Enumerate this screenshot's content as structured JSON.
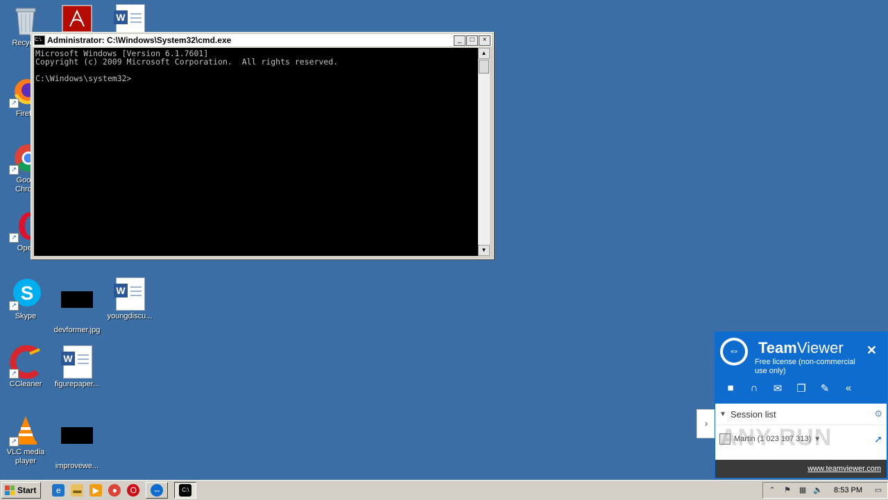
{
  "desktop": {
    "icons": [
      {
        "label": "Recycle"
      },
      {
        "label": "Firefo"
      },
      {
        "label": "Goog\nChron"
      },
      {
        "label": "Oper"
      },
      {
        "label": "Skype"
      },
      {
        "label": "devformer.jpg"
      },
      {
        "label": "youngdiscu..."
      },
      {
        "label": "CCleaner"
      },
      {
        "label": "figurepaper..."
      },
      {
        "label": "VLC media\nplayer"
      },
      {
        "label": "improvewe..."
      }
    ]
  },
  "cmd": {
    "title": "Administrator: C:\\Windows\\System32\\cmd.exe",
    "icon_text": "C:\\.",
    "output": "Microsoft Windows [Version 6.1.7601]\nCopyright (c) 2009 Microsoft Corporation.  All rights reserved.\n\nC:\\Windows\\system32>"
  },
  "teamviewer": {
    "brand_bold": "Team",
    "brand_light": "Viewer",
    "license": "Free license (non-commercial use only)",
    "session_list": "Session list",
    "partner": "Martin (1 023 107 313)",
    "footer_link": "www.teamviewer.com"
  },
  "watermark": "ANY RUN",
  "taskbar": {
    "start": "Start",
    "time": "8:53 PM"
  }
}
